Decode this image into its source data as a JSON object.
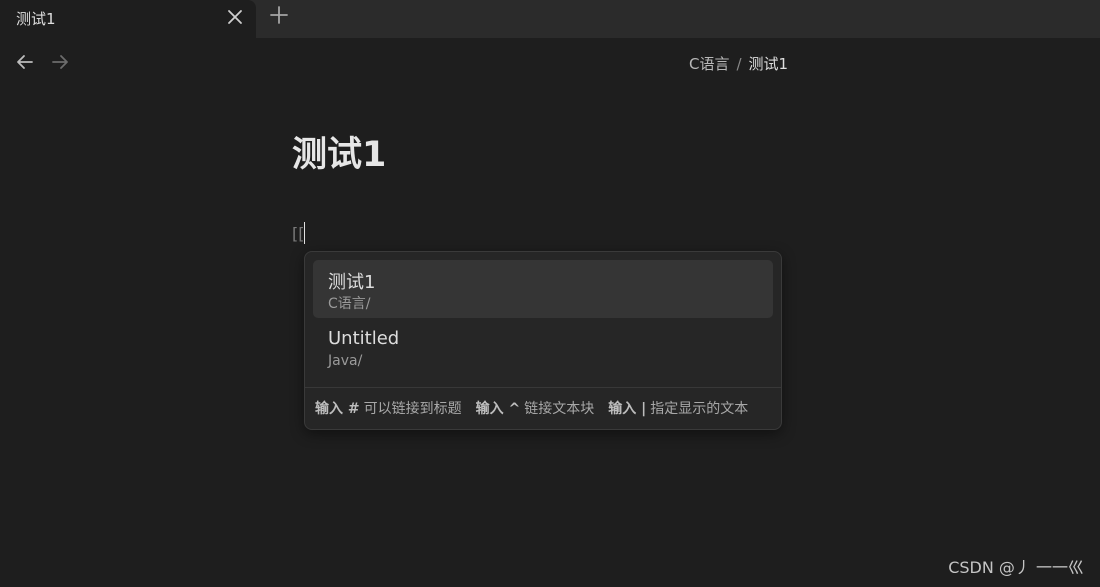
{
  "tab": {
    "title": "测试1"
  },
  "breadcrumb": {
    "folder": "C语言",
    "separator": "/",
    "current": "测试1"
  },
  "document": {
    "title": "测试1",
    "typed_text": "[["
  },
  "popup": {
    "suggestions": [
      {
        "title": "测试1",
        "path": "C语言/"
      },
      {
        "title": "Untitled",
        "path": "Java/"
      }
    ],
    "hints": [
      {
        "key": "输入 #",
        "text": "可以链接到标题"
      },
      {
        "key": "输入 ^",
        "text": "链接文本块"
      },
      {
        "key": "输入 |",
        "text": "指定显示的文本"
      }
    ]
  },
  "watermark": "CSDN @丿 一一巛",
  "icons": {
    "tab_close": "close-icon",
    "new_tab": "plus-icon",
    "back": "arrow-left-icon",
    "forward": "arrow-right-icon"
  }
}
